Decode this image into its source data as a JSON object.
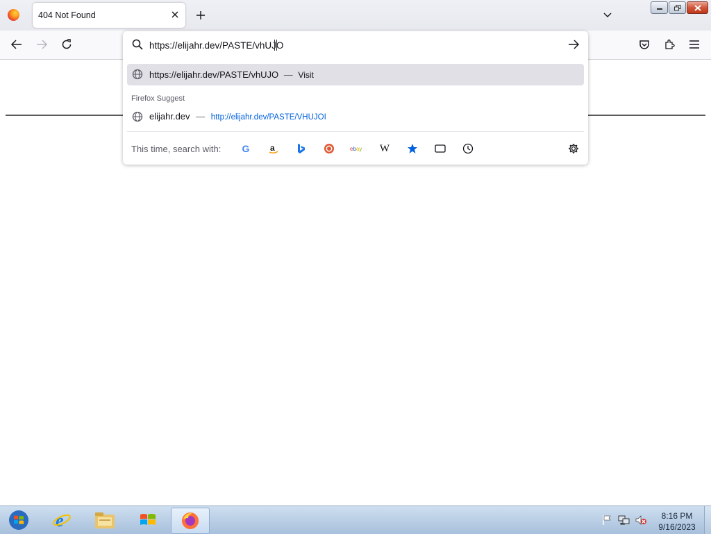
{
  "browser": {
    "tab": {
      "title": "404 Not Found"
    },
    "url_input": {
      "value": "https://elijahr.dev/PASTE/vhUJO"
    }
  },
  "urlbar_popup": {
    "visit_row": {
      "url": "https://elijahr.dev/PASTE/vhUJO",
      "dash": "—",
      "action": "Visit"
    },
    "section_title": "Firefox Suggest",
    "suggest_row": {
      "title": "elijahr.dev",
      "dash": "—",
      "url": "http://elijahr.dev/PASTE/VHUJOI"
    },
    "search_with_label": "This time, search with:",
    "engines": [
      "google-icon",
      "amazon-icon",
      "bing-icon",
      "duckduckgo-icon",
      "ebay-icon",
      "wikipedia-icon",
      "bookmarks-icon",
      "tabs-icon",
      "history-icon"
    ]
  },
  "taskbar": {
    "time": "8:16 PM",
    "date": "9/16/2023",
    "items": [
      "start-button",
      "internet-explorer-icon",
      "file-explorer-icon",
      "windows-media-icon",
      "firefox-icon"
    ]
  },
  "colors": {
    "accent": "#0060df",
    "link": "#0060df",
    "hover_row": "#e0e0e6"
  }
}
